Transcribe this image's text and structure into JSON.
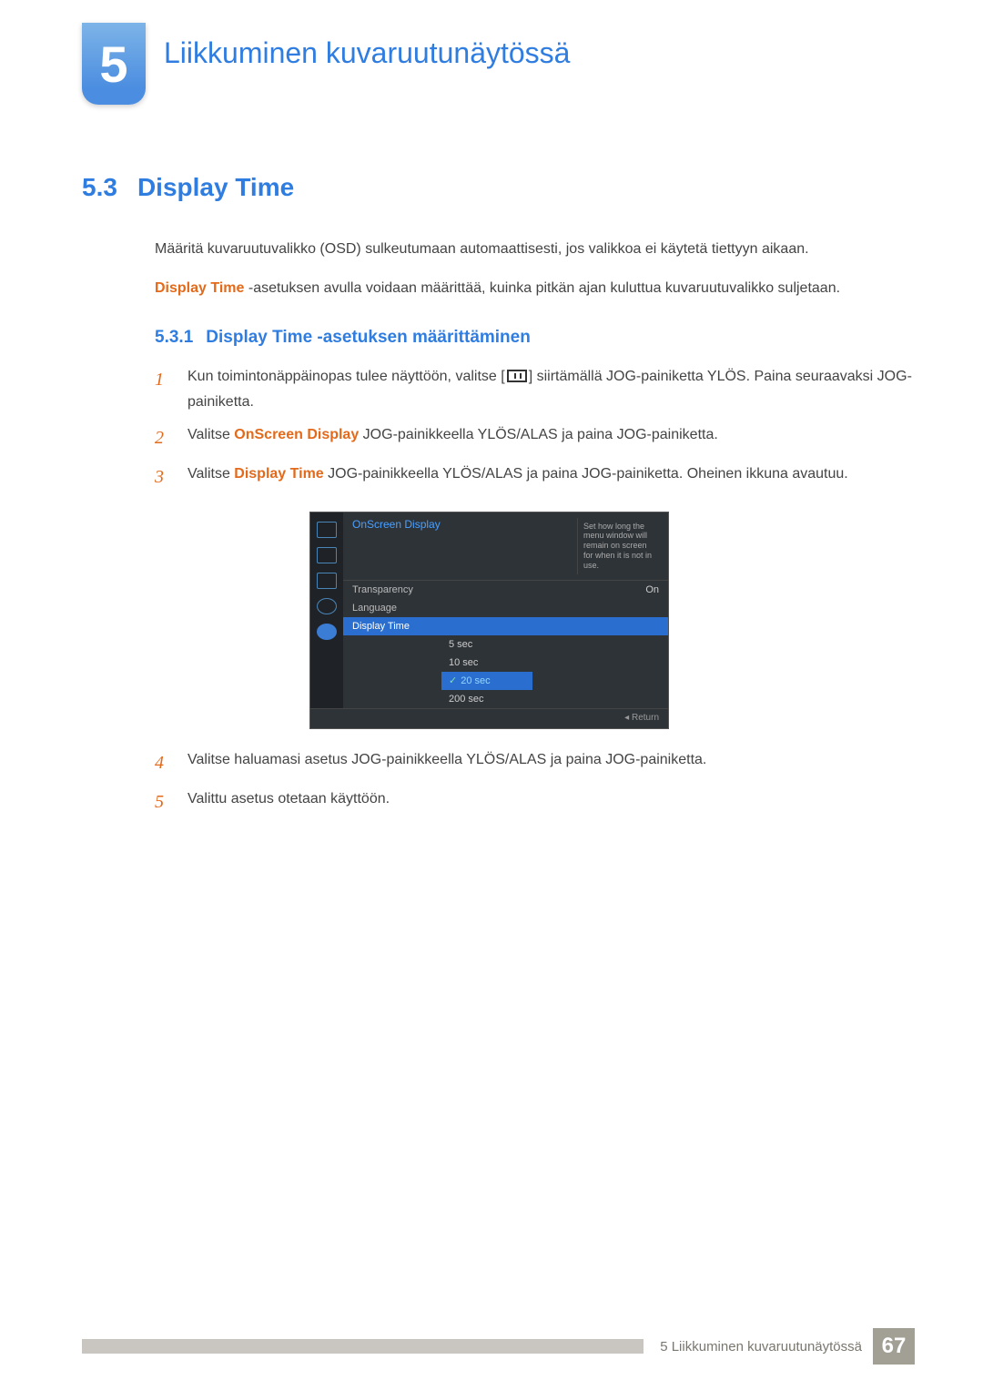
{
  "chapter": {
    "number": "5",
    "title": "Liikkuminen kuvaruutunäytössä"
  },
  "section": {
    "number": "5.3",
    "title": "Display Time"
  },
  "intro": {
    "p1": "Määritä kuvaruutuvalikko (OSD) sulkeutumaan automaattisesti, jos valikkoa ei käytetä tiettyyn aikaan.",
    "p2_prefix": "Display Time",
    "p2_rest": " -asetuksen avulla voidaan määrittää, kuinka pitkän ajan kuluttua kuvaruutuvalikko suljetaan."
  },
  "subsection": {
    "number": "5.3.1",
    "title": "Display Time -asetuksen määrittäminen"
  },
  "steps": {
    "s1a": "Kun toimintonäppäinopas tulee näyttöön, valitse [",
    "s1b": "] siirtämällä JOG-painiketta YLÖS. Paina seuraavaksi JOG-painiketta.",
    "s2_pre": "Valitse ",
    "s2_orange": "OnScreen Display",
    "s2_post": " JOG-painikkeella YLÖS/ALAS ja paina JOG-painiketta.",
    "s3_pre": "Valitse ",
    "s3_orange": "Display Time",
    "s3_post": " JOG-painikkeella YLÖS/ALAS ja paina JOG-painiketta. Oheinen ikkuna avautuu.",
    "s4": "Valitse haluamasi asetus JOG-painikkeella YLÖS/ALAS ja paina JOG-painiketta.",
    "s5": "Valittu asetus otetaan käyttöön."
  },
  "osd": {
    "header": "OnScreen Display",
    "help": "Set how long the menu window will remain on screen for when it is not in use.",
    "rows": [
      {
        "label": "Transparency",
        "value": "On",
        "active": false
      },
      {
        "label": "Language",
        "value": "",
        "active": false
      },
      {
        "label": "Display Time",
        "value": "",
        "active": true
      }
    ],
    "options": [
      "5 sec",
      "10 sec",
      "20 sec",
      "200 sec"
    ],
    "selected_option": "20 sec",
    "return": "Return"
  },
  "footer": {
    "label": "5 Liikkuminen kuvaruutunäytössä",
    "page": "67"
  }
}
